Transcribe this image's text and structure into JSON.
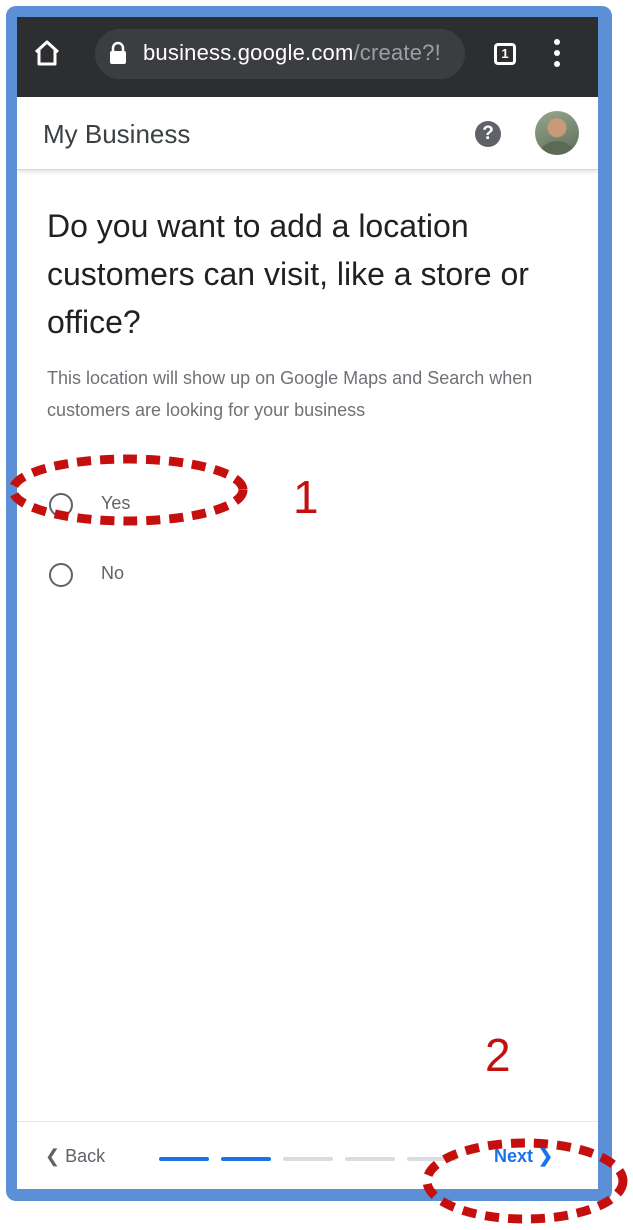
{
  "browser": {
    "url_host": "business.google.com",
    "url_path": "/create?!",
    "tab_count": "1",
    "icons": [
      "home-icon",
      "lock-icon",
      "tab-switcher-icon",
      "overflow-menu-icon"
    ]
  },
  "appbar": {
    "title": "My Business",
    "help_label": "?",
    "icons": [
      "help-icon",
      "avatar"
    ]
  },
  "content": {
    "question": "Do you want to add a location customers can visit, like a store or office?",
    "description": "This location will show up on Google Maps and Search when customers are looking for your business",
    "options": [
      {
        "label": "Yes",
        "selected": false
      },
      {
        "label": "No",
        "selected": false
      }
    ]
  },
  "footer": {
    "back_label": "Back",
    "next_label": "Next",
    "progress": {
      "total_steps": 5,
      "completed_steps": 2
    }
  },
  "annotations": [
    {
      "label": "1"
    },
    {
      "label": "2"
    }
  ],
  "colors": {
    "frame": "#5b8fd6",
    "browser_bar": "#2d2e30",
    "accent": "#1a73e8",
    "annotation": "#c50f0f"
  }
}
